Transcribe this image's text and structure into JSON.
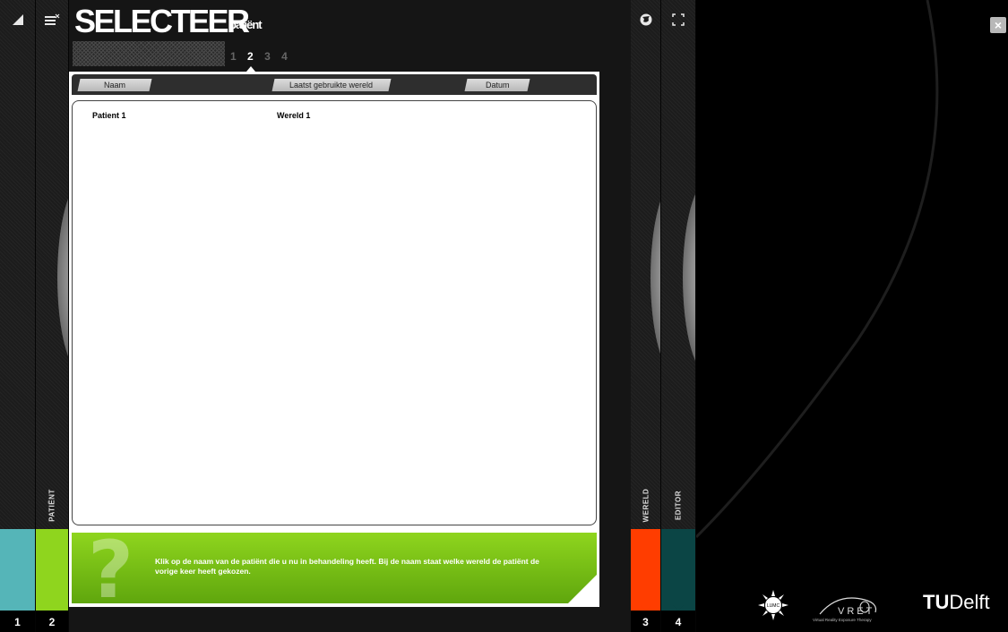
{
  "header": {
    "title": "SELECTEER",
    "subtitle": "patiënt",
    "steps": [
      "1",
      "2",
      "3",
      "4"
    ],
    "active_step": "2"
  },
  "left_strips": [
    {
      "icon": "collapse-arrow-icon",
      "number": "1",
      "color": "#55b5b8"
    },
    {
      "icon": "list-icon",
      "label": "PATIËNT",
      "number": "2",
      "color": "#8fd51e"
    }
  ],
  "right_strips": [
    {
      "icon": "globe-icon",
      "label": "WERELD",
      "number": "3",
      "color": "#ff3d00"
    },
    {
      "icon": "expand-icon",
      "label": "EDITOR",
      "number": "4",
      "color": "#0b4545"
    }
  ],
  "table": {
    "columns": [
      "Naam",
      "Laatst gebruikte wereld",
      "Datum"
    ],
    "rows": [
      {
        "naam": "Patient 1",
        "wereld": "Wereld 1",
        "datum": ""
      }
    ]
  },
  "hint": {
    "text": "Klik op de naam van de patiënt die u nu in behandeling heeft. Bij de naam staat welke wereld de patiënt de vorige keer heeft gekozen."
  },
  "footer": {
    "logo_lumc": "LUMC",
    "logo_vret_caption": "Virtual Reality Exposure Therapy",
    "logo_tudelft_tu": "TU",
    "logo_tudelft_delft": "Delft"
  },
  "close_label": "×"
}
